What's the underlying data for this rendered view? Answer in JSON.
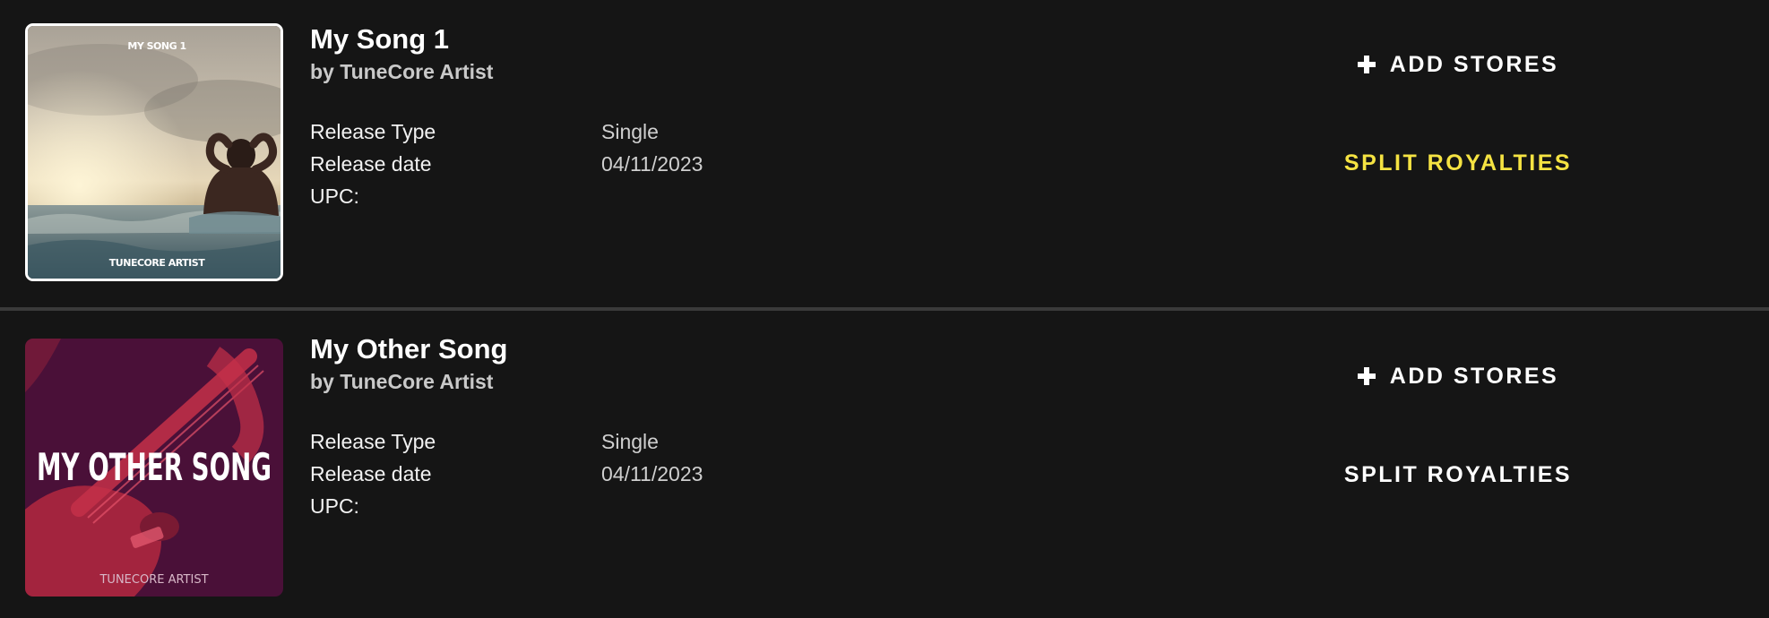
{
  "releases": [
    {
      "title": "My Song 1",
      "artist": "by TuneCore Artist",
      "cover": {
        "top_text": "MY SONG 1",
        "bottom_text": "TUNECORE ARTIST",
        "icon": "beach-swimmer-artwork"
      },
      "details": [
        {
          "label": "Release Type",
          "value": "Single"
        },
        {
          "label": "Release date",
          "value": "04/11/2023"
        },
        {
          "label": "UPC:",
          "value": ""
        }
      ],
      "actions": {
        "add_stores": "ADD STORES",
        "split_royalties": "SPLIT ROYALTIES"
      }
    },
    {
      "title": "My Other Song",
      "artist": "by TuneCore Artist",
      "cover": {
        "main_text": "MY OTHER SONG",
        "bottom_text": "TUNECORE ARTIST",
        "icon": "guitar-artwork"
      },
      "details": [
        {
          "label": "Release Type",
          "value": "Single"
        },
        {
          "label": "Release date",
          "value": "04/11/2023"
        },
        {
          "label": "UPC:",
          "value": ""
        }
      ],
      "actions": {
        "add_stores": "ADD STORES",
        "split_royalties": "SPLIT ROYALTIES"
      }
    }
  ],
  "colors": {
    "background": "#151515",
    "divider": "#3a3a3a",
    "highlight": "#f5e342",
    "cover2_bg": "#4a1038"
  }
}
